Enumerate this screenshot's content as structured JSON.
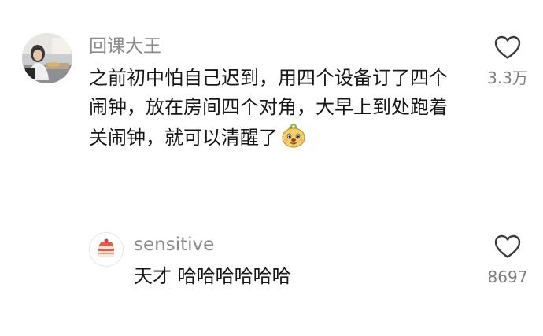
{
  "comment": {
    "username": "回课大王",
    "text_lines": [
      "之前初中怕自己迟到，用四个设备订了四个",
      "闹钟，放在房间四个对角，大早上到处跑着",
      "关闹钟，就可以清醒了"
    ],
    "emoji": "smiling-dog-sticker",
    "like_count": "3.3万"
  },
  "reply": {
    "username": "sensitive",
    "text": "天才 哈哈哈哈哈哈",
    "like_count": "8697"
  },
  "colors": {
    "username": "#8a8a8a",
    "text": "#161616",
    "like_count": "#7d7d7d",
    "heart_outline": "#3a3a3a",
    "background": "#ffffff"
  }
}
